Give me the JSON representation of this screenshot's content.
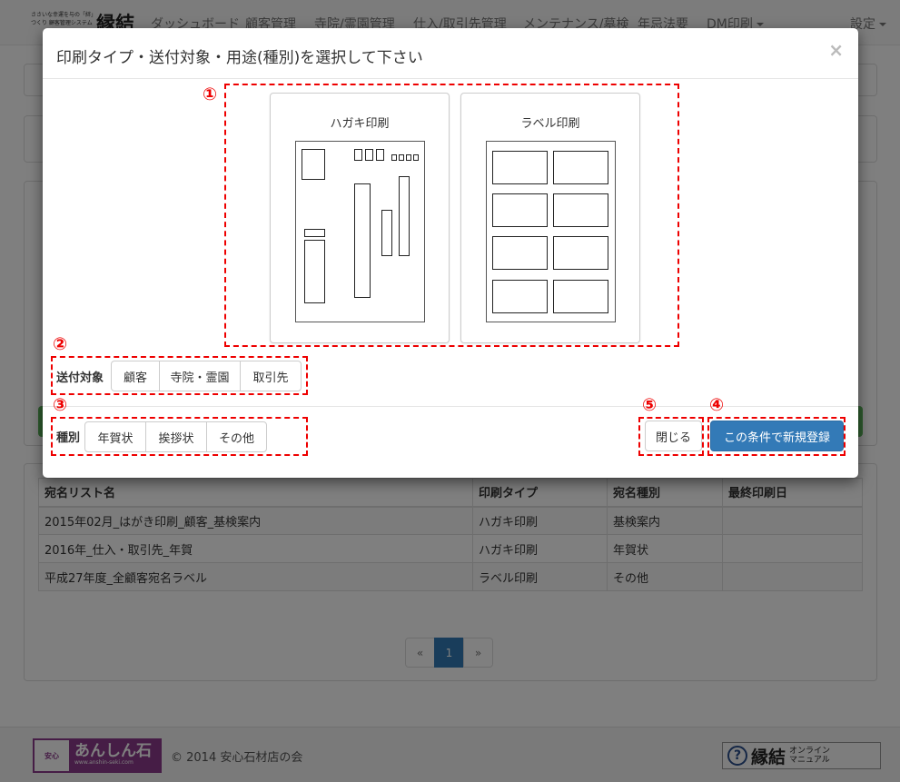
{
  "navbar": {
    "brand_tagline": "ささいな幸運を与の「絆」つくり 顧客管理システム",
    "brand_name": "縁結",
    "items": [
      {
        "label": "ダッシュボード"
      },
      {
        "label": "顧客管理"
      },
      {
        "label": "寺院/霊園管理"
      },
      {
        "label": "仕入/取引先管理"
      },
      {
        "label": "メンテナンス/墓検"
      },
      {
        "label": "年忌法要"
      },
      {
        "label": "DM印刷"
      }
    ],
    "settings_label": "設定"
  },
  "table": {
    "headers": [
      "宛名リスト名",
      "印刷タイプ",
      "宛名種別",
      "最終印刷日"
    ],
    "rows": [
      [
        "2015年02月_はがき印刷_顧客_基検案内",
        "ハガキ印刷",
        "基検案内",
        ""
      ],
      [
        "2016年_仕入・取引先_年賀",
        "ハガキ印刷",
        "年賀状",
        ""
      ],
      [
        "平成27年度_全顧客宛名ラベル",
        "ラベル印刷",
        "その他",
        ""
      ]
    ]
  },
  "pagination": {
    "prev": "«",
    "current": "1",
    "next": "»"
  },
  "footer": {
    "badge": "安心",
    "logo_text": "あんしん石",
    "logo_url": "www.anshin-seki.com",
    "copyright": "© 2014 安心石材店の会",
    "manual_brand": "縁結",
    "manual_line1": "オンライン",
    "manual_line2": "マニュアル"
  },
  "modal": {
    "title": "印刷タイプ・送付対象・用途(種別)を選択して下さい",
    "close_symbol": "×",
    "print_types": [
      {
        "label": "ハガキ印刷"
      },
      {
        "label": "ラベル印刷"
      }
    ],
    "recipient": {
      "label": "送付対象",
      "options": [
        "顧客",
        "寺院・霊園",
        "取引先"
      ]
    },
    "category": {
      "label": "種別",
      "options": [
        "年賀状",
        "挨拶状",
        "その他"
      ]
    },
    "close_button": "閉じる",
    "submit_button": "この条件で新規登録",
    "annotations": [
      "①",
      "②",
      "③",
      "④",
      "⑤"
    ],
    "annotation_color": "#e00000"
  }
}
